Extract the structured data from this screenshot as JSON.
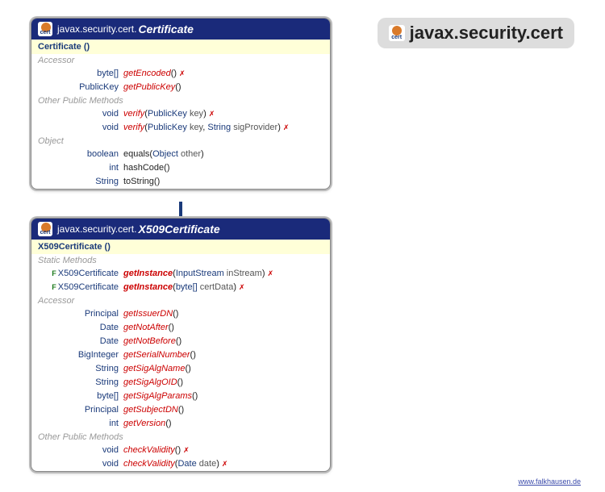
{
  "page": {
    "title": "javax.security.cert",
    "attribution": "www.falkhausen.de"
  },
  "icons": {
    "certLabel": "cert"
  },
  "classes": {
    "certificate": {
      "package": "javax.security.cert.",
      "className": "Certificate",
      "constructor": "Certificate ()",
      "sections": [
        {
          "label": "Accessor",
          "methods": [
            {
              "final": false,
              "return": "byte[]",
              "name": "getEncoded",
              "abstract": true,
              "bold": false,
              "params": "()",
              "throws": true
            },
            {
              "final": false,
              "return": "PublicKey",
              "name": "getPublicKey",
              "abstract": true,
              "bold": false,
              "params": "()",
              "throws": false
            }
          ]
        },
        {
          "label": "Other Public Methods",
          "methods": [
            {
              "final": false,
              "return": "void",
              "name": "verify",
              "abstract": true,
              "bold": false,
              "paramsParts": [
                [
                  "PublicKey",
                  "key"
                ]
              ],
              "close": ")",
              "throws": true
            },
            {
              "final": false,
              "return": "void",
              "name": "verify",
              "abstract": true,
              "bold": false,
              "paramsParts": [
                [
                  "PublicKey",
                  "key"
                ],
                [
                  "String",
                  "sigProvider"
                ]
              ],
              "close": ")",
              "throws": true
            }
          ]
        },
        {
          "label": "Object",
          "methods": [
            {
              "final": false,
              "return": "boolean",
              "name": "equals",
              "abstract": false,
              "bold": false,
              "paramsParts": [
                [
                  "Object",
                  "other"
                ]
              ],
              "close": ")",
              "throws": false
            },
            {
              "final": false,
              "return": "int",
              "name": "hashCode",
              "abstract": false,
              "bold": false,
              "params": "()",
              "throws": false
            },
            {
              "final": false,
              "return": "String",
              "name": "toString",
              "abstract": false,
              "bold": false,
              "params": "()",
              "throws": false
            }
          ]
        }
      ]
    },
    "x509": {
      "package": "javax.security.cert.",
      "className": "X509Certificate",
      "constructor": "X509Certificate ()",
      "sections": [
        {
          "label": "Static Methods",
          "methods": [
            {
              "final": true,
              "return": "X509Certificate",
              "name": "getInstance",
              "abstract": true,
              "bold": true,
              "paramsParts": [
                [
                  "InputStream",
                  "inStream"
                ]
              ],
              "close": ")",
              "throws": true
            },
            {
              "final": true,
              "return": "X509Certificate",
              "name": "getInstance",
              "abstract": true,
              "bold": true,
              "paramsParts": [
                [
                  "byte[]",
                  "certData"
                ]
              ],
              "close": ")",
              "throws": true
            }
          ]
        },
        {
          "label": "Accessor",
          "methods": [
            {
              "final": false,
              "return": "Principal",
              "name": "getIssuerDN",
              "abstract": true,
              "bold": false,
              "params": "()",
              "throws": false
            },
            {
              "final": false,
              "return": "Date",
              "name": "getNotAfter",
              "abstract": true,
              "bold": false,
              "params": "()",
              "throws": false
            },
            {
              "final": false,
              "return": "Date",
              "name": "getNotBefore",
              "abstract": true,
              "bold": false,
              "params": "()",
              "throws": false
            },
            {
              "final": false,
              "return": "BigInteger",
              "name": "getSerialNumber",
              "abstract": true,
              "bold": false,
              "params": "()",
              "throws": false
            },
            {
              "final": false,
              "return": "String",
              "name": "getSigAlgName",
              "abstract": true,
              "bold": false,
              "params": "()",
              "throws": false
            },
            {
              "final": false,
              "return": "String",
              "name": "getSigAlgOID",
              "abstract": true,
              "bold": false,
              "params": "()",
              "throws": false
            },
            {
              "final": false,
              "return": "byte[]",
              "name": "getSigAlgParams",
              "abstract": true,
              "bold": false,
              "params": "()",
              "throws": false
            },
            {
              "final": false,
              "return": "Principal",
              "name": "getSubjectDN",
              "abstract": true,
              "bold": false,
              "params": "()",
              "throws": false
            },
            {
              "final": false,
              "return": "int",
              "name": "getVersion",
              "abstract": true,
              "bold": false,
              "params": "()",
              "throws": false
            }
          ]
        },
        {
          "label": "Other Public Methods",
          "methods": [
            {
              "final": false,
              "return": "void",
              "name": "checkValidity",
              "abstract": true,
              "bold": false,
              "params": "()",
              "throws": true
            },
            {
              "final": false,
              "return": "void",
              "name": "checkValidity",
              "abstract": true,
              "bold": false,
              "paramsParts": [
                [
                  "Date",
                  "date"
                ]
              ],
              "close": ")",
              "throws": true
            }
          ]
        }
      ]
    }
  }
}
